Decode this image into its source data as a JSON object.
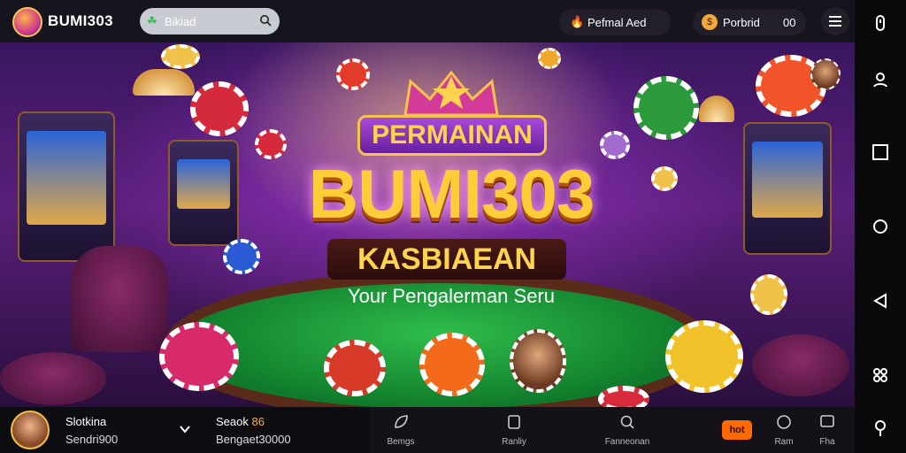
{
  "header": {
    "brand": "BUMI303",
    "search": {
      "value": "Bikiad"
    },
    "pill1": {
      "label": "Pefmal Aed"
    },
    "pill2": {
      "label": "Porbrid",
      "count": "00"
    }
  },
  "banner": {
    "title_top": "PERMAINAN",
    "title_main": "BUMI303",
    "title_sub": "KASBIAEAN",
    "tagline": "Your Pengalerman Seru"
  },
  "footer": {
    "user_name": "Slotkina",
    "user_sub": "Sendri900",
    "balance_label": "Seaok",
    "balance_highlight": "86",
    "balance_value": "Bengaet30000",
    "tabs": [
      {
        "label": "Bemgs",
        "icon": "leaf-icon"
      },
      {
        "label": "Ranliy",
        "icon": "document-icon"
      },
      {
        "label": "Fanneonan",
        "icon": "search-icon"
      },
      {
        "label": "Ram",
        "icon": "circle-icon"
      },
      {
        "label": "Fha",
        "icon": "chat-icon"
      }
    ],
    "hot_badge": "hot"
  },
  "colors": {
    "accent": "#f5c44a",
    "brand_purple": "#6a1ea0",
    "hot": "#ff6a00"
  }
}
